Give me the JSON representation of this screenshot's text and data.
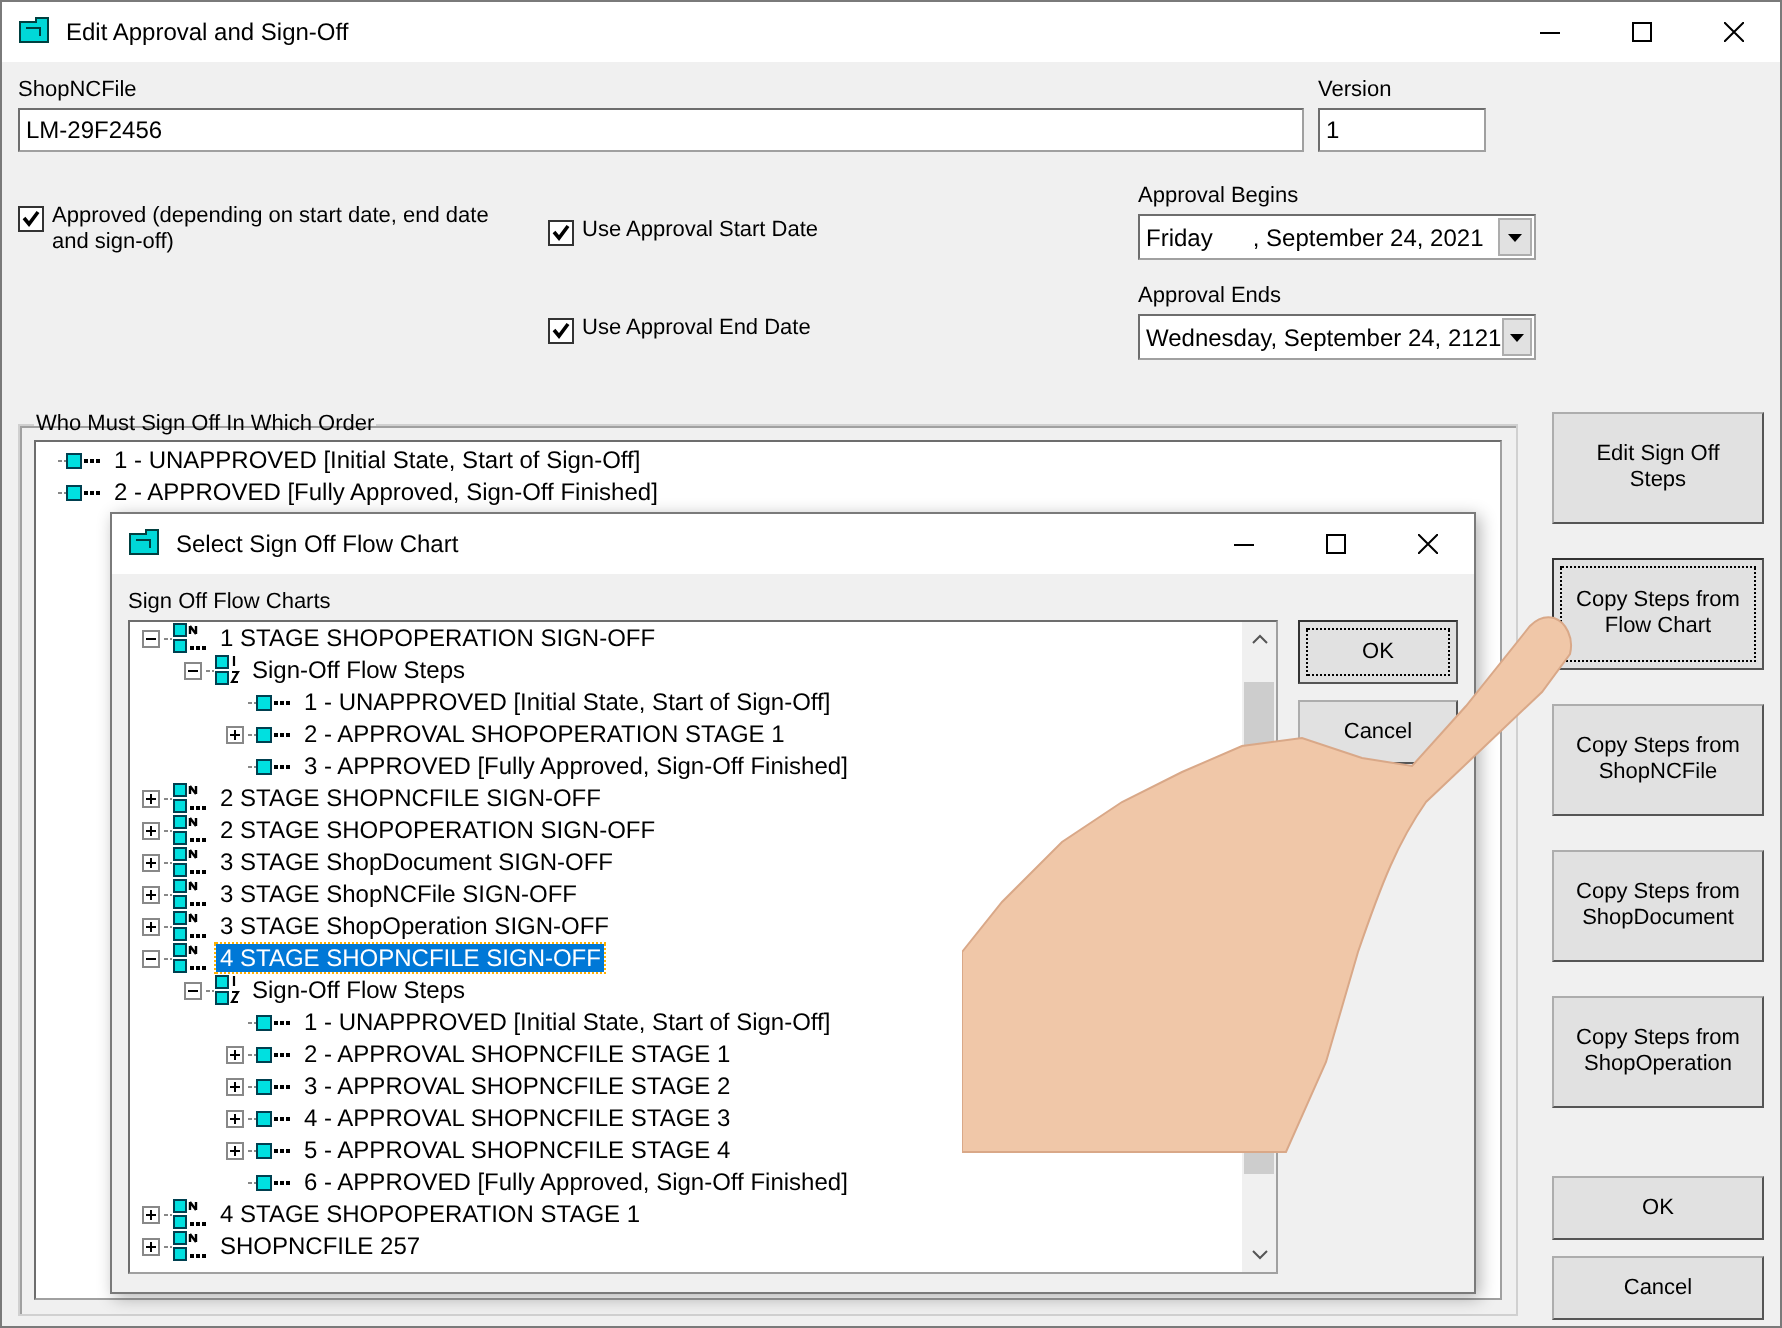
{
  "window": {
    "title": "Edit Approval and Sign-Off"
  },
  "shop_nc_file": {
    "label": "ShopNCFile",
    "value": "LM-29F2456"
  },
  "version": {
    "label": "Version",
    "value": "1"
  },
  "options": [
    {
      "label": "Approved (depending on start date, end date and sign-off)",
      "checked": true
    },
    {
      "label": "Use Approval Start Date",
      "checked": true
    },
    {
      "label": "Use Approval End Date",
      "checked": true
    }
  ],
  "approval_begins": {
    "label": "Approval Begins",
    "value": "Friday      , September 24, 2021"
  },
  "approval_ends": {
    "label": "Approval Ends",
    "value": "Wednesday, September 24, 2121"
  },
  "sign_off_order": {
    "title": "Who Must Sign Off In Which Order",
    "steps": [
      {
        "kind": "step",
        "label": "1 - UNAPPROVED [Initial State, Start of Sign-Off]"
      },
      {
        "kind": "step",
        "label": "2 - APPROVED [Fully Approved, Sign-Off Finished]"
      }
    ]
  },
  "side_buttons": [
    {
      "label": "Edit Sign Off Steps",
      "focused": false
    },
    {
      "label": "Copy Steps from Flow Chart",
      "focused": true
    },
    {
      "label": "Copy Steps from ShopNCFile",
      "focused": false
    },
    {
      "label": "Copy Steps from ShopDocument",
      "focused": false
    },
    {
      "label": "Copy Steps from ShopOperation",
      "focused": false
    }
  ],
  "buttons": [
    "OK",
    "Cancel"
  ],
  "dialog": {
    "title": "Select Sign Off Flow Chart",
    "tree_label": "Sign Off Flow Charts",
    "charts": [
      {
        "kind": "chart",
        "label": "1 STAGE SHOPOPERATION SIGN-OFF",
        "expanded": true,
        "selected": false,
        "children": [
          {
            "kind": "steps",
            "label": "Sign-Off Flow Steps",
            "expanded": true,
            "children": [
              {
                "kind": "step",
                "label": "1 - UNAPPROVED [Initial State, Start of Sign-Off]"
              },
              {
                "kind": "step",
                "label": "2 - APPROVAL SHOPOPERATION STAGE 1",
                "expanded": false
              },
              {
                "kind": "step",
                "label": "3 - APPROVED [Fully Approved, Sign-Off Finished]"
              }
            ]
          }
        ]
      },
      {
        "kind": "chart",
        "label": "2 STAGE SHOPNCFILE SIGN-OFF",
        "expanded": false,
        "selected": false
      },
      {
        "kind": "chart",
        "label": "2 STAGE SHOPOPERATION SIGN-OFF",
        "expanded": false,
        "selected": false
      },
      {
        "kind": "chart",
        "label": "3 STAGE ShopDocument SIGN-OFF",
        "expanded": false,
        "selected": false
      },
      {
        "kind": "chart",
        "label": "3 STAGE ShopNCFile SIGN-OFF",
        "expanded": false,
        "selected": false
      },
      {
        "kind": "chart",
        "label": "3 STAGE ShopOperation SIGN-OFF",
        "expanded": false,
        "selected": false
      },
      {
        "kind": "chart",
        "label": "4 STAGE SHOPNCFILE SIGN-OFF",
        "expanded": true,
        "selected": true,
        "children": [
          {
            "kind": "steps",
            "label": "Sign-Off Flow Steps",
            "expanded": true,
            "children": [
              {
                "kind": "step",
                "label": "1 - UNAPPROVED [Initial State, Start of Sign-Off]"
              },
              {
                "kind": "step",
                "label": "2 - APPROVAL SHOPNCFILE STAGE 1",
                "expanded": false
              },
              {
                "kind": "step",
                "label": "3 - APPROVAL SHOPNCFILE STAGE 2",
                "expanded": false
              },
              {
                "kind": "step",
                "label": "4 - APPROVAL SHOPNCFILE STAGE 3",
                "expanded": false
              },
              {
                "kind": "step",
                "label": "5 - APPROVAL SHOPNCFILE STAGE 4",
                "expanded": false
              },
              {
                "kind": "step",
                "label": "6 - APPROVED [Fully Approved, Sign-Off Finished]"
              }
            ]
          }
        ]
      },
      {
        "kind": "chart",
        "label": "4 STAGE SHOPOPERATION STAGE 1",
        "expanded": false,
        "selected": false
      },
      {
        "kind": "chart",
        "label": "SHOPNCFILE 257",
        "expanded": false,
        "selected": false
      }
    ],
    "buttons": [
      "OK",
      "Cancel"
    ]
  }
}
